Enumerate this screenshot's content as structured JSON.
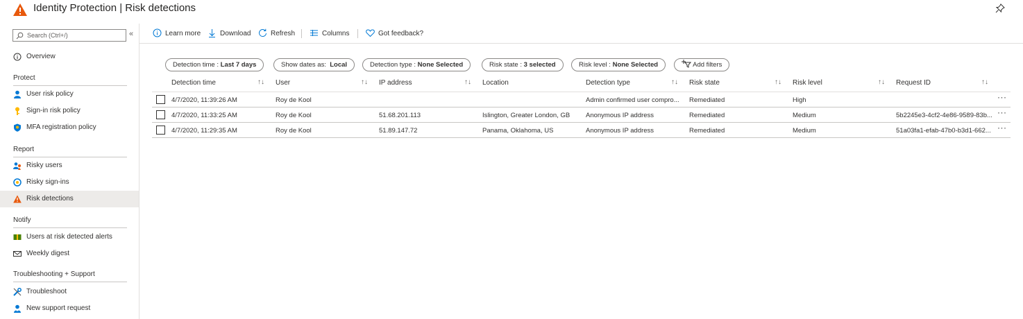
{
  "window": {
    "title": "Identity Protection | Risk detections",
    "title_icon": "warning-triangle-icon",
    "pin_icon": "pin-icon",
    "accent_warning": "#e8590c"
  },
  "sidebar": {
    "search_placeholder": "Search (Ctrl+/)",
    "collapse_glyph": "«",
    "overview": {
      "label": "Overview",
      "icon": "info-circle-icon"
    },
    "sections": [
      {
        "header": "Protect",
        "items": [
          {
            "label": "User risk policy",
            "icon": "user-icon"
          },
          {
            "label": "Sign-in risk policy",
            "icon": "key-icon"
          },
          {
            "label": "MFA registration policy",
            "icon": "shield-icon"
          }
        ]
      },
      {
        "header": "Report",
        "items": [
          {
            "label": "Risky users",
            "icon": "users-icon"
          },
          {
            "label": "Risky sign-ins",
            "icon": "signin-icon"
          },
          {
            "label": "Risk detections",
            "icon": "warning-icon",
            "selected": true
          }
        ]
      },
      {
        "header": "Notify",
        "items": [
          {
            "label": "Users at risk detected alerts",
            "icon": "alert-flag-icon"
          },
          {
            "label": "Weekly digest",
            "icon": "mail-icon"
          }
        ]
      },
      {
        "header": "Troubleshooting + Support",
        "items": [
          {
            "label": "Troubleshoot",
            "icon": "wrench-icon"
          },
          {
            "label": "New support request",
            "icon": "support-person-icon"
          }
        ]
      }
    ]
  },
  "toolbar": {
    "learn_more": "Learn more",
    "download": "Download",
    "refresh": "Refresh",
    "columns": "Columns",
    "feedback": "Got feedback?"
  },
  "filters": {
    "detection_time_label": "Detection time : ",
    "detection_time_value": "Last 7 days",
    "show_dates_label": "Show dates as:  ",
    "show_dates_value": "Local",
    "detection_type_label": "Detection type : ",
    "detection_type_value": "None Selected",
    "risk_state_label": "Risk state : ",
    "risk_state_value": "3 selected",
    "risk_level_label": "Risk level : ",
    "risk_level_value": "None Selected",
    "add_filters": "Add filters"
  },
  "table": {
    "columns": [
      "Detection time",
      "User",
      "IP address",
      "Location",
      "Detection type",
      "Risk state",
      "Risk level",
      "Request ID"
    ],
    "sort_glyph": "↑↓",
    "more_glyph": "···",
    "rows": [
      {
        "time": "4/7/2020, 11:39:26 AM",
        "user": "Roy de Kool",
        "ip": "",
        "location": "",
        "type": "Admin confirmed user compro...",
        "state": "Remediated",
        "level": "High",
        "request": ""
      },
      {
        "time": "4/7/2020, 11:33:25 AM",
        "user": "Roy de Kool",
        "ip": "51.68.201.113",
        "location": "Islington, Greater London, GB",
        "type": "Anonymous IP address",
        "state": "Remediated",
        "level": "Medium",
        "request": "5b2245e3-4cf2-4e86-9589-83b..."
      },
      {
        "time": "4/7/2020, 11:29:35 AM",
        "user": "Roy de Kool",
        "ip": "51.89.147.72",
        "location": "Panama, Oklahoma, US",
        "type": "Anonymous IP address",
        "state": "Remediated",
        "level": "Medium",
        "request": "51a03fa1-efab-47b0-b3d1-662..."
      }
    ]
  }
}
